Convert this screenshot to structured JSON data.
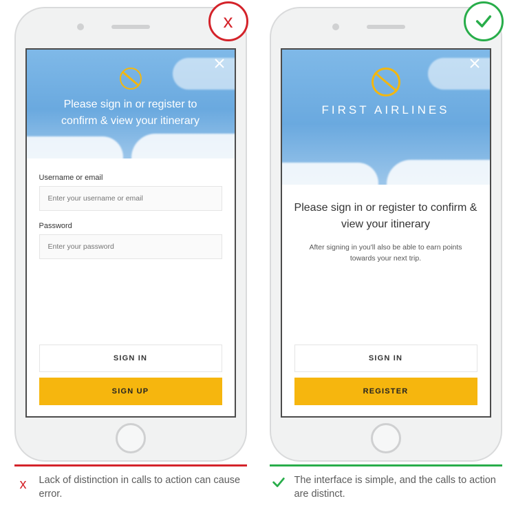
{
  "left": {
    "badge_mark": "x",
    "sky_heading": "Please sign in or register to confirm & view your itinerary",
    "username_label": "Username or email",
    "username_placeholder": "Enter your username or email",
    "password_label": "Password",
    "password_placeholder": "Enter your password",
    "signin_label": "SIGN IN",
    "signup_label": "SIGN UP",
    "caption_mark": "x",
    "caption_text": "Lack of distinction in calls to action can cause error."
  },
  "right": {
    "brand": "FIRST AIRLINES",
    "intro_title": "Please sign in or register to confirm & view your itinerary",
    "intro_sub": "After signing in you'll also be able to earn points towards your next trip.",
    "signin_label": "SIGN IN",
    "register_label": "REGISTER",
    "caption_text": "The interface is simple, and the calls to action are distinct."
  }
}
